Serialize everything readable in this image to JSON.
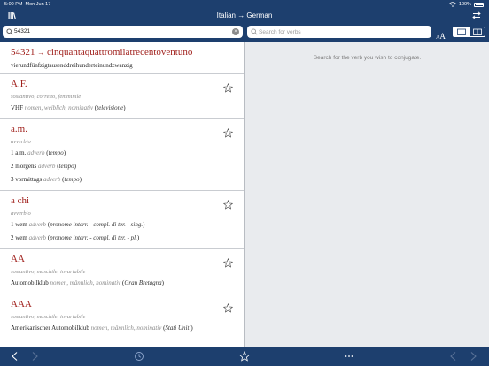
{
  "status": {
    "time": "5:00 PM",
    "date": "Mon Jun 17",
    "battery": "100%"
  },
  "header": {
    "title": "Italian → German"
  },
  "search": {
    "query": "54321",
    "verb_placeholder": "Search for verbs"
  },
  "font_size": {
    "small": "A",
    "large": "A"
  },
  "conjugation": {
    "hint": "Search for the verb you wish to conjugate."
  },
  "entries": [
    {
      "headword": "54321",
      "arrow": "→",
      "headword_suffix": "cinquantaquattromilatrecentoventuno",
      "translation": "vierundfünfzigtausenddreihunderteinundzwanzig"
    },
    {
      "headword": "A.F.",
      "grammar": "sostantivo, corretto, femminile",
      "t1": {
        "word": "VHF",
        "gram": "nomen, weiblich, nominativ",
        "open": "(",
        "context": "televisione",
        "close": ")"
      }
    },
    {
      "headword": "a.m.",
      "grammar": "avverbio",
      "t1": {
        "num": "1",
        "word": "a.m.",
        "gram": "adverb",
        "open": "(",
        "context": "tempo",
        "close": ")"
      },
      "t2": {
        "num": "2",
        "word": "morgens",
        "gram": "adverb",
        "open": "(",
        "context": "tempo",
        "close": ")"
      },
      "t3": {
        "num": "3",
        "word": "vormittags",
        "gram": "adverb",
        "open": "(",
        "context": "tempo",
        "close": ")"
      }
    },
    {
      "headword": "a chi",
      "grammar": "avverbio",
      "t1": {
        "num": "1",
        "word": "wem",
        "gram": "adverb",
        "open": "(",
        "context": "pronome interr. - compl. di ter. - sing.",
        "close": ")"
      },
      "t2": {
        "num": "2",
        "word": "wem",
        "gram": "adverb",
        "open": "(",
        "context": "pronome interr. - compl. di ter. - pl.",
        "close": ")"
      }
    },
    {
      "headword": "AA",
      "grammar": "sostantivo, maschile, invariabile",
      "t1": {
        "word": "Automobilklub",
        "gram": "nomen, männlich, nominativ",
        "open": "(",
        "context": "Gran Bretagna",
        "close": ")"
      }
    },
    {
      "headword": "AAA",
      "grammar": "sostantivo, maschile, invariabile",
      "t1": {
        "word": "Amerikanischer Automobilklub",
        "gram": "nomen, männlich, nominativ",
        "open": "(",
        "context": "Stati Uniti",
        "close": ")"
      }
    }
  ],
  "colors": {
    "chrome": "#1d3f6e",
    "headword": "#a0201c",
    "grammar": "#8b8b8b"
  }
}
